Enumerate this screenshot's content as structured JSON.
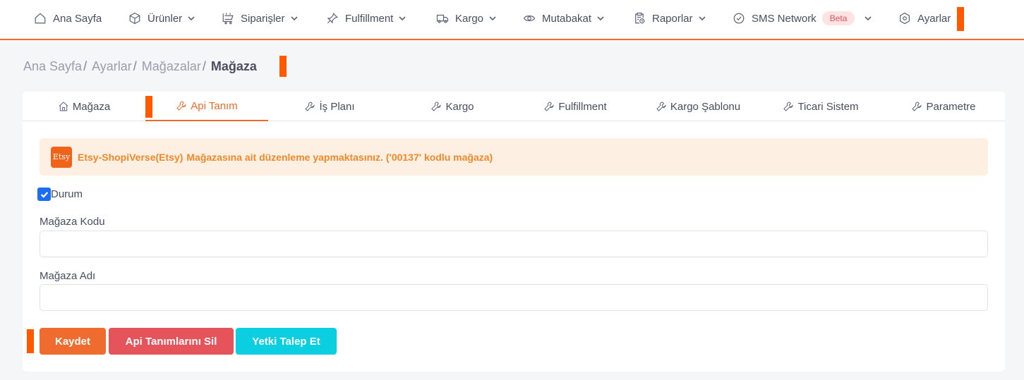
{
  "nav": {
    "home": "Ana Sayfa",
    "products": "Ürünler",
    "orders": "Siparişler",
    "fulfillment": "Fulfillment",
    "cargo": "Kargo",
    "reconciliation": "Mutabakat",
    "reports": "Raporlar",
    "sms": "SMS Network",
    "sms_badge": "Beta",
    "settings": "Ayarlar"
  },
  "breadcrumb": {
    "items": [
      "Ana Sayfa",
      "Ayarlar",
      "Mağazalar"
    ],
    "separator": "/",
    "current": "Mağaza"
  },
  "tabs": [
    {
      "label": "Mağaza",
      "icon": "home-icon",
      "active": false
    },
    {
      "label": "Api Tanım",
      "icon": "wrench-icon",
      "active": true
    },
    {
      "label": "İş Planı",
      "icon": "wrench-icon",
      "active": false
    },
    {
      "label": "Kargo",
      "icon": "wrench-icon",
      "active": false
    },
    {
      "label": "Fulfillment",
      "icon": "wrench-icon",
      "active": false
    },
    {
      "label": "Kargo Şablonu",
      "icon": "wrench-icon",
      "active": false
    },
    {
      "label": "Ticari Sistem",
      "icon": "wrench-icon",
      "active": false
    },
    {
      "label": "Parametre",
      "icon": "wrench-icon",
      "active": false
    }
  ],
  "alert": {
    "logo_text": "Etsy",
    "store_name": "Etsy-ShopiVerse(Etsy)",
    "message": "Mağazasına ait düzenleme yapmaktasınız. ('00137' kodlu mağaza)"
  },
  "form": {
    "status_label": "Durum",
    "status_checked": true,
    "store_code_label": "Mağaza Kodu",
    "store_code_value": "",
    "store_name_label": "Mağaza Adı",
    "store_name_value": ""
  },
  "buttons": {
    "save": "Kaydet",
    "delete_api": "Api Tanımlarını Sil",
    "request_auth": "Yetki Talep Et"
  },
  "colors": {
    "accent": "#ef6b2e",
    "danger": "#e5545a",
    "info": "#0bcfe0",
    "checkbox": "#1b6ef3",
    "marker": "#ff5a00"
  }
}
